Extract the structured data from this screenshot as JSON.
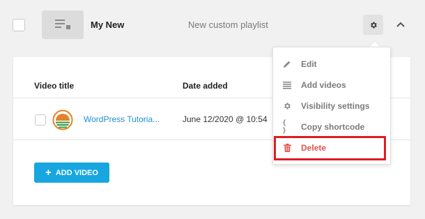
{
  "playlist": {
    "name": "My New",
    "description": "New custom playlist"
  },
  "table": {
    "columns": [
      "Video title",
      "Date added"
    ],
    "rows": [
      {
        "title": "WordPress Tutoria...",
        "date": "June 12/2020 @ 10:54"
      }
    ]
  },
  "add_video_label": "ADD VIDEO",
  "menu": {
    "items": [
      {
        "label": "Edit",
        "icon": "pencil-icon"
      },
      {
        "label": "Add videos",
        "icon": "list-icon"
      },
      {
        "label": "Visibility settings",
        "icon": "gear-icon"
      },
      {
        "label": "Copy shortcode",
        "icon": "braces-icon"
      },
      {
        "label": "Delete",
        "icon": "trash-icon"
      }
    ]
  },
  "colors": {
    "accent": "#17a6e0",
    "link": "#1f8fd0",
    "danger": "#e2554e",
    "highlight": "#e01b24"
  }
}
